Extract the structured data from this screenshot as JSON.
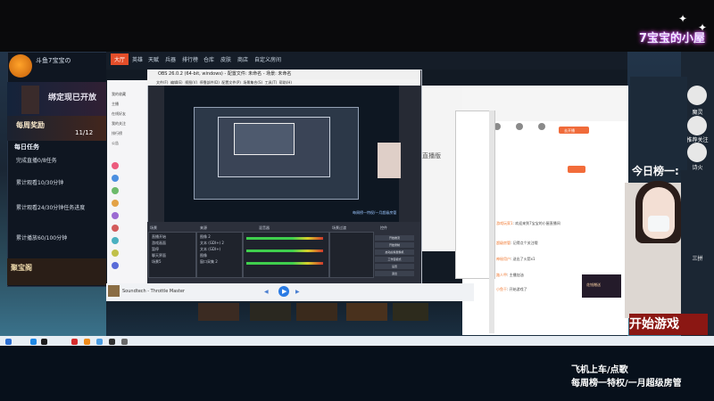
{
  "overlay": {
    "brand": "7宝宝的小屋",
    "bottom_lines": [
      "飞机上车/点歌",
      "每周榜一特权/一月超级房管"
    ],
    "today_top": "今日榜一:",
    "start_game": "开始游戏"
  },
  "left_panel": {
    "streamer": "斗鱼7宝宝の",
    "banner_title": "绑定现已开放",
    "banner_count": "11/12",
    "weekly_reward": "每周奖励",
    "daily_task": "每日任务",
    "rows": [
      "完成直播0/8任务",
      "累计观看10/30分钟",
      "累计观看24/30分钟任务进度",
      "累计播放60/100分钟"
    ],
    "treasure": "聚宝阁"
  },
  "right_sidebar": {
    "items": [
      "魔灵",
      "推荐关注",
      "诗火",
      "三拼"
    ]
  },
  "tabs": [
    "大厅",
    "英雄",
    "天赋",
    "兵器",
    "排行榜",
    "仓库",
    "皮肤",
    "商店",
    "自定义房间"
  ],
  "obs": {
    "title": "OBS 26.0.2 (64-bit, windows) - 配置文件: 未命名 - 场景: 未命名",
    "menu": [
      "文件(F)",
      "编辑(E)",
      "视图(V)",
      "停靠部件(D)",
      "配置文件(P)",
      "场景集合(S)",
      "工具(T)",
      "帮助(H)"
    ],
    "panels": [
      "场景",
      "来源",
      "混音器",
      "场景过渡",
      "控件"
    ],
    "scenes": [
      "直播开始",
      "游戏画面",
      "暂停",
      "聊天界面",
      "场景5"
    ],
    "sources": [
      "图像 2",
      "文本 (GDI+) 2",
      "文本 (GDI+)",
      "图像",
      "窗口采集 2"
    ],
    "controls": [
      "开始推流",
      "开始录制",
      "启动虚拟摄像机",
      "工作室模式",
      "设置",
      "退出"
    ],
    "preview_caption": "每周榜一特权/一月超级房管"
  },
  "music": {
    "title": "Soundtech - Throttle Master"
  },
  "win_a": {
    "items": [
      "我的收藏",
      "主播",
      "在线好友",
      "我的关注",
      "排行榜",
      "公告",
      "直播间",
      "精彩推荐",
      "娱乐天地",
      "直播分类"
    ]
  },
  "win_d": {
    "title": "直播版",
    "button": "去开播",
    "chat": [
      {
        "name": "游戏玩家1",
        "text": "欢迎来到7宝宝的小屋直播间"
      },
      {
        "name": "超级房管",
        "text": "记得点个关注哦"
      },
      {
        "name": "神秘用户",
        "text": "送出了火箭x1"
      },
      {
        "name": "路人甲",
        "text": "主播加油"
      },
      {
        "name": "小鱼干",
        "text": "开始游戏了"
      }
    ]
  },
  "gift_label": "花钱赠送"
}
